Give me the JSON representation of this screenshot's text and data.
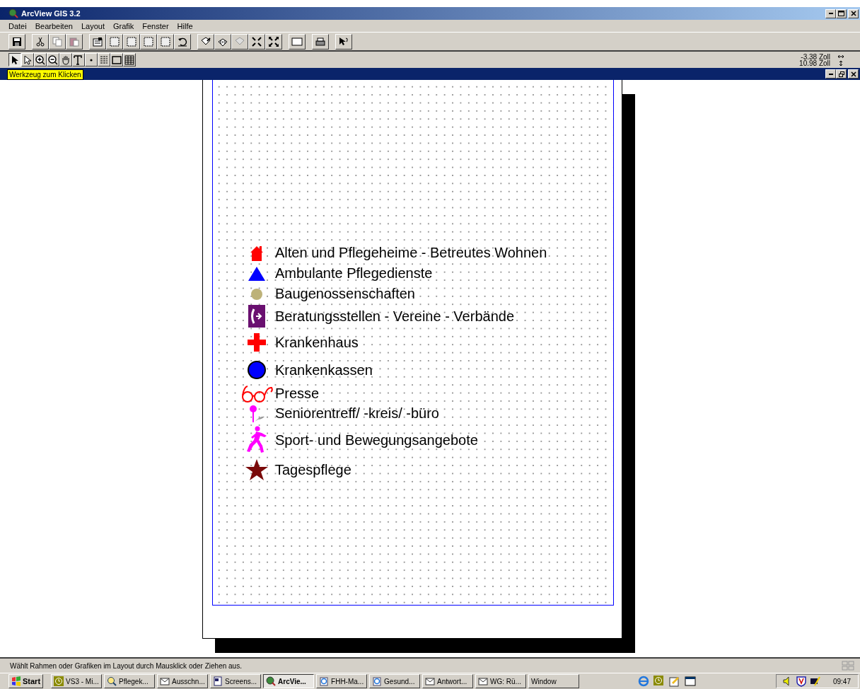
{
  "window": {
    "title": "ArcView GIS 3.2"
  },
  "menu": [
    "Datei",
    "Bearbeiten",
    "Layout",
    "Grafik",
    "Fenster",
    "Hilfe"
  ],
  "tools": [
    {
      "selected": true
    },
    {
      "selected": false
    },
    {
      "selected": false
    },
    {
      "selected": false
    },
    {
      "selected": false
    },
    {
      "selected": false
    },
    {
      "selected": false
    },
    {
      "selected": false
    },
    {
      "selected": false
    },
    {
      "selected": false
    }
  ],
  "coordinates": {
    "x": "-3.38 Zoll",
    "y": "10.98 Zoll"
  },
  "tooltip": "Werkzeug zum Klicken",
  "legend": [
    {
      "kind": "house",
      "label": "Alten und Pflegeheime - Betreutes Wohnen"
    },
    {
      "kind": "triangle",
      "label": "Ambulante Pflegedienste"
    },
    {
      "kind": "dot",
      "label": "Baugenossenschaften"
    },
    {
      "kind": "phone",
      "label": "Beratungsstellen - Vereine - Verbände"
    },
    {
      "kind": "cross",
      "label": "Krankenhaus"
    },
    {
      "kind": "circle",
      "label": "Krankenkassen"
    },
    {
      "kind": "glasses",
      "label": "Presse"
    },
    {
      "kind": "pin",
      "label": "Seniorentreff/ -kreis/ -büro"
    },
    {
      "kind": "runner",
      "label": "Sport- und Bewegungsangebote"
    },
    {
      "kind": "star",
      "label": "Tagespflege"
    }
  ],
  "status_bar": "Wählt Rahmen oder Grafiken im Layout durch Mausklick oder Ziehen aus.",
  "taskbar": {
    "start": "Start",
    "buttons": [
      {
        "label": "VS3 - Mi...",
        "selected": false
      },
      {
        "label": "Pflegek...",
        "selected": false
      },
      {
        "label": "Ausschn...",
        "selected": false
      },
      {
        "label": "Screens...",
        "selected": false
      },
      {
        "label": "ArcVie...",
        "selected": true
      },
      {
        "label": "FHH-Ma...",
        "selected": false
      },
      {
        "label": "Gesund...",
        "selected": false
      },
      {
        "label": "Antwort...",
        "selected": false
      },
      {
        "label": "WG: Rü...",
        "selected": false
      },
      {
        "label": "Window",
        "selected": false
      }
    ],
    "clock": "09:47"
  }
}
